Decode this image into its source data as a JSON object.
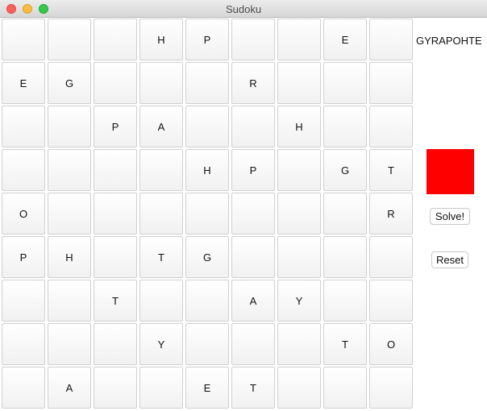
{
  "window": {
    "title": "Sudoku"
  },
  "board": [
    [
      "",
      "",
      "",
      "H",
      "P",
      "",
      "",
      "E",
      ""
    ],
    [
      "E",
      "G",
      "",
      "",
      "",
      "R",
      "",
      "",
      ""
    ],
    [
      "",
      "",
      "P",
      "A",
      "",
      "",
      "H",
      "",
      ""
    ],
    [
      "",
      "",
      "",
      "",
      "H",
      "P",
      "",
      "G",
      "T"
    ],
    [
      "O",
      "",
      "",
      "",
      "",
      "",
      "",
      "",
      "R"
    ],
    [
      "P",
      "H",
      "",
      "T",
      "G",
      "",
      "",
      "",
      ""
    ],
    [
      "",
      "",
      "T",
      "",
      "",
      "A",
      "Y",
      "",
      ""
    ],
    [
      "",
      "",
      "",
      "Y",
      "",
      "",
      "",
      "T",
      "O"
    ],
    [
      "",
      "A",
      "",
      "",
      "E",
      "T",
      "",
      "",
      ""
    ]
  ],
  "sidebar": {
    "word": "GYRAPOHTE",
    "status_color": "#ff0000",
    "solve_label": "Solve!",
    "reset_label": "Reset"
  }
}
